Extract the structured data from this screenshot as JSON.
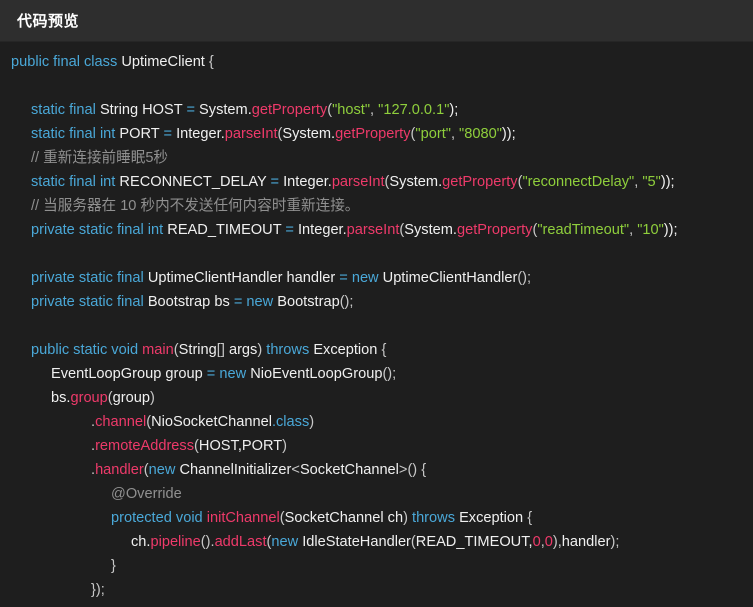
{
  "header": {
    "title": "代码预览"
  },
  "colors": {
    "keyword": "#4aa8d8",
    "method": "#ee3a6a",
    "string": "#8fcf3c",
    "comment": "#909090",
    "plain": "#f0f0f0",
    "punct": "#c8c8c8"
  },
  "code": {
    "lines": [
      {
        "indent": 0,
        "tokens": [
          {
            "t": "public final class ",
            "c": "keyword"
          },
          {
            "t": "UptimeClient ",
            "c": "plain"
          },
          {
            "t": "{",
            "c": "punct"
          }
        ]
      },
      {
        "indent": 0,
        "tokens": []
      },
      {
        "indent": 1,
        "tokens": [
          {
            "t": "static final ",
            "c": "keyword"
          },
          {
            "t": "String HOST ",
            "c": "plain"
          },
          {
            "t": "= ",
            "c": "keyword"
          },
          {
            "t": "System.",
            "c": "plain"
          },
          {
            "t": "getProperty",
            "c": "method"
          },
          {
            "t": "(",
            "c": "punct"
          },
          {
            "t": "\"host\"",
            "c": "string"
          },
          {
            "t": ", ",
            "c": "punct"
          },
          {
            "t": "\"127.0.0.1\"",
            "c": "string"
          },
          {
            "t": ");",
            "c": "plain"
          }
        ]
      },
      {
        "indent": 1,
        "tokens": [
          {
            "t": "static final int ",
            "c": "keyword"
          },
          {
            "t": "PORT ",
            "c": "plain"
          },
          {
            "t": "= ",
            "c": "keyword"
          },
          {
            "t": "Integer.",
            "c": "plain"
          },
          {
            "t": "parseInt",
            "c": "method"
          },
          {
            "t": "(",
            "c": "punct"
          },
          {
            "t": "System.",
            "c": "plain"
          },
          {
            "t": "getProperty",
            "c": "method"
          },
          {
            "t": "(",
            "c": "punct"
          },
          {
            "t": "\"port\"",
            "c": "string"
          },
          {
            "t": ", ",
            "c": "punct"
          },
          {
            "t": "\"8080\"",
            "c": "string"
          },
          {
            "t": "));",
            "c": "plain"
          }
        ]
      },
      {
        "indent": 1,
        "tokens": [
          {
            "t": "// 重新连接前睡眠5秒",
            "c": "comment"
          }
        ]
      },
      {
        "indent": 1,
        "tokens": [
          {
            "t": "static final int ",
            "c": "keyword"
          },
          {
            "t": "RECONNECT_DELAY ",
            "c": "plain"
          },
          {
            "t": "= ",
            "c": "keyword"
          },
          {
            "t": "Integer.",
            "c": "plain"
          },
          {
            "t": "parseInt",
            "c": "method"
          },
          {
            "t": "(",
            "c": "punct"
          },
          {
            "t": "System.",
            "c": "plain"
          },
          {
            "t": "getProperty",
            "c": "method"
          },
          {
            "t": "(",
            "c": "punct"
          },
          {
            "t": "\"reconnectDelay\"",
            "c": "string"
          },
          {
            "t": ", ",
            "c": "punct"
          },
          {
            "t": "\"5\"",
            "c": "string"
          },
          {
            "t": "));",
            "c": "plain"
          }
        ]
      },
      {
        "indent": 1,
        "tokens": [
          {
            "t": "// 当服务器在 10 秒内不发送任何内容时重新连接。",
            "c": "comment"
          }
        ]
      },
      {
        "indent": 1,
        "tokens": [
          {
            "t": "private static final int ",
            "c": "keyword"
          },
          {
            "t": "READ_TIMEOUT ",
            "c": "plain"
          },
          {
            "t": "= ",
            "c": "keyword"
          },
          {
            "t": "Integer.",
            "c": "plain"
          },
          {
            "t": "parseInt",
            "c": "method"
          },
          {
            "t": "(",
            "c": "punct"
          },
          {
            "t": "System.",
            "c": "plain"
          },
          {
            "t": "getProperty",
            "c": "method"
          },
          {
            "t": "(",
            "c": "punct"
          },
          {
            "t": "\"readTimeout\"",
            "c": "string"
          },
          {
            "t": ", ",
            "c": "punct"
          },
          {
            "t": "\"10\"",
            "c": "string"
          },
          {
            "t": "));",
            "c": "plain"
          }
        ]
      },
      {
        "indent": 0,
        "tokens": []
      },
      {
        "indent": 1,
        "tokens": [
          {
            "t": "private static final ",
            "c": "keyword"
          },
          {
            "t": "UptimeClientHandler handler ",
            "c": "plain"
          },
          {
            "t": "= ",
            "c": "keyword"
          },
          {
            "t": "new ",
            "c": "keyword"
          },
          {
            "t": "UptimeClientHandler",
            "c": "plain"
          },
          {
            "t": "();",
            "c": "punct"
          }
        ]
      },
      {
        "indent": 1,
        "tokens": [
          {
            "t": "private static final ",
            "c": "keyword"
          },
          {
            "t": "Bootstrap bs ",
            "c": "plain"
          },
          {
            "t": "= ",
            "c": "keyword"
          },
          {
            "t": "new ",
            "c": "keyword"
          },
          {
            "t": "Bootstrap",
            "c": "plain"
          },
          {
            "t": "();",
            "c": "punct"
          }
        ]
      },
      {
        "indent": 0,
        "tokens": []
      },
      {
        "indent": 1,
        "tokens": [
          {
            "t": "public static void ",
            "c": "keyword"
          },
          {
            "t": "main",
            "c": "method"
          },
          {
            "t": "(",
            "c": "punct"
          },
          {
            "t": "String",
            "c": "plain"
          },
          {
            "t": "[] ",
            "c": "punct"
          },
          {
            "t": "args",
            "c": "plain"
          },
          {
            "t": ") ",
            "c": "punct"
          },
          {
            "t": "throws ",
            "c": "keyword"
          },
          {
            "t": "Exception ",
            "c": "plain"
          },
          {
            "t": "{",
            "c": "punct"
          }
        ]
      },
      {
        "indent": 2,
        "tokens": [
          {
            "t": "EventLoopGroup group ",
            "c": "plain"
          },
          {
            "t": "= ",
            "c": "keyword"
          },
          {
            "t": "new ",
            "c": "keyword"
          },
          {
            "t": "NioEventLoopGroup",
            "c": "plain"
          },
          {
            "t": "();",
            "c": "punct"
          }
        ]
      },
      {
        "indent": 2,
        "tokens": [
          {
            "t": "bs.",
            "c": "plain"
          },
          {
            "t": "group",
            "c": "method"
          },
          {
            "t": "(",
            "c": "punct"
          },
          {
            "t": "group",
            "c": "plain"
          },
          {
            "t": ")",
            "c": "punct"
          }
        ]
      },
      {
        "indent": 4,
        "tokens": [
          {
            "t": ".",
            "c": "punct"
          },
          {
            "t": "channel",
            "c": "method"
          },
          {
            "t": "(",
            "c": "punct"
          },
          {
            "t": "NioSocketChannel",
            "c": "plain"
          },
          {
            "t": ".class",
            "c": "keyword"
          },
          {
            "t": ")",
            "c": "punct"
          }
        ]
      },
      {
        "indent": 4,
        "tokens": [
          {
            "t": ".",
            "c": "punct"
          },
          {
            "t": "remoteAddress",
            "c": "method"
          },
          {
            "t": "(",
            "c": "punct"
          },
          {
            "t": "HOST,PORT",
            "c": "plain"
          },
          {
            "t": ")",
            "c": "punct"
          }
        ]
      },
      {
        "indent": 4,
        "tokens": [
          {
            "t": ".",
            "c": "punct"
          },
          {
            "t": "handler",
            "c": "method"
          },
          {
            "t": "(",
            "c": "punct"
          },
          {
            "t": "new ",
            "c": "keyword"
          },
          {
            "t": "ChannelInitializer",
            "c": "plain"
          },
          {
            "t": "<",
            "c": "punct"
          },
          {
            "t": "SocketChannel",
            "c": "plain"
          },
          {
            "t": ">() {",
            "c": "punct"
          }
        ]
      },
      {
        "indent": 5,
        "tokens": [
          {
            "t": "@Override",
            "c": "comment"
          }
        ]
      },
      {
        "indent": 5,
        "tokens": [
          {
            "t": "protected void ",
            "c": "keyword"
          },
          {
            "t": "initChannel",
            "c": "method"
          },
          {
            "t": "(",
            "c": "punct"
          },
          {
            "t": "SocketChannel ch",
            "c": "plain"
          },
          {
            "t": ") ",
            "c": "punct"
          },
          {
            "t": "throws ",
            "c": "keyword"
          },
          {
            "t": "Exception ",
            "c": "plain"
          },
          {
            "t": "{",
            "c": "punct"
          }
        ]
      },
      {
        "indent": 6,
        "tokens": [
          {
            "t": "ch.",
            "c": "plain"
          },
          {
            "t": "pipeline",
            "c": "method"
          },
          {
            "t": "().",
            "c": "punct"
          },
          {
            "t": "addLast",
            "c": "method"
          },
          {
            "t": "(",
            "c": "punct"
          },
          {
            "t": "new ",
            "c": "keyword"
          },
          {
            "t": "IdleStateHandler",
            "c": "plain"
          },
          {
            "t": "(",
            "c": "punct"
          },
          {
            "t": "READ_TIMEOUT,",
            "c": "plain"
          },
          {
            "t": "0",
            "c": "method"
          },
          {
            "t": ",",
            "c": "punct"
          },
          {
            "t": "0",
            "c": "method"
          },
          {
            "t": "),",
            "c": "punct"
          },
          {
            "t": "handler",
            "c": "plain"
          },
          {
            "t": ");",
            "c": "punct"
          }
        ]
      },
      {
        "indent": 5,
        "tokens": [
          {
            "t": "}",
            "c": "punct"
          }
        ]
      },
      {
        "indent": 4,
        "tokens": [
          {
            "t": "});",
            "c": "punct"
          }
        ]
      }
    ]
  }
}
